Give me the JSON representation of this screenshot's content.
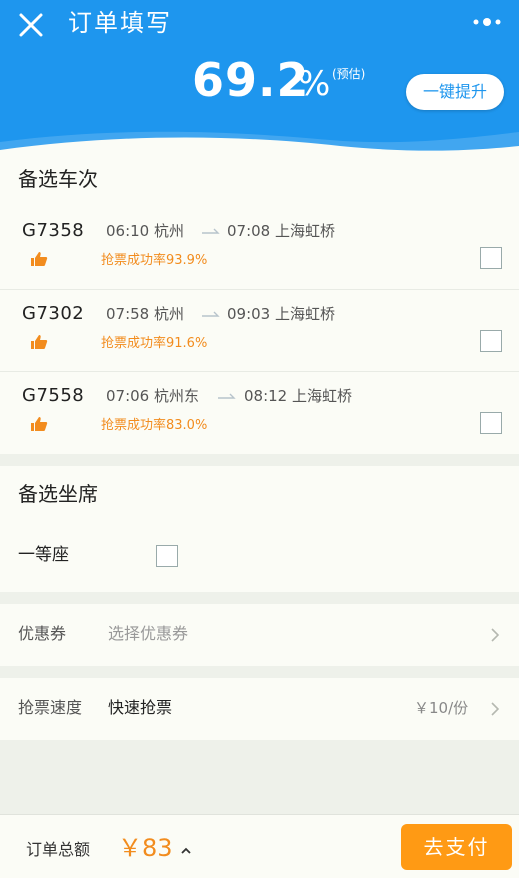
{
  "header": {
    "title": "订单填写",
    "close_icon": "close-icon",
    "more_icon": "more-dots-icon",
    "rate_value": "69.2",
    "rate_unit": "%",
    "rate_note": "(预估)",
    "boost_label": "一键提升",
    "color": "#1e96ee"
  },
  "trains": {
    "title": "备选车次",
    "items": [
      {
        "no": "G7358",
        "dep_time": "06:10",
        "dep_station": "杭州",
        "arr_time": "07:08",
        "arr_station": "上海虹桥",
        "success": "抢票成功率93.9%"
      },
      {
        "no": "G7302",
        "dep_time": "07:58",
        "dep_station": "杭州",
        "arr_time": "09:03",
        "arr_station": "上海虹桥",
        "success": "抢票成功率91.6%"
      },
      {
        "no": "G7558",
        "dep_time": "07:06",
        "dep_station": "杭州东",
        "arr_time": "08:12",
        "arr_station": "上海虹桥",
        "success": "抢票成功率83.0%"
      }
    ]
  },
  "seats": {
    "title": "备选坐席",
    "items": [
      {
        "label": "一等座"
      }
    ]
  },
  "coupon": {
    "label": "优惠券",
    "placeholder": "选择优惠券"
  },
  "speed": {
    "label": "抢票速度",
    "value": "快速抢票",
    "price": "￥10/份"
  },
  "footer": {
    "total_label": "订单总额",
    "total_value": "￥83",
    "pay_label": "去支付"
  },
  "colors": {
    "accent": "#f28c1e",
    "pay": "#ff9a14",
    "primary": "#1e96ee"
  }
}
